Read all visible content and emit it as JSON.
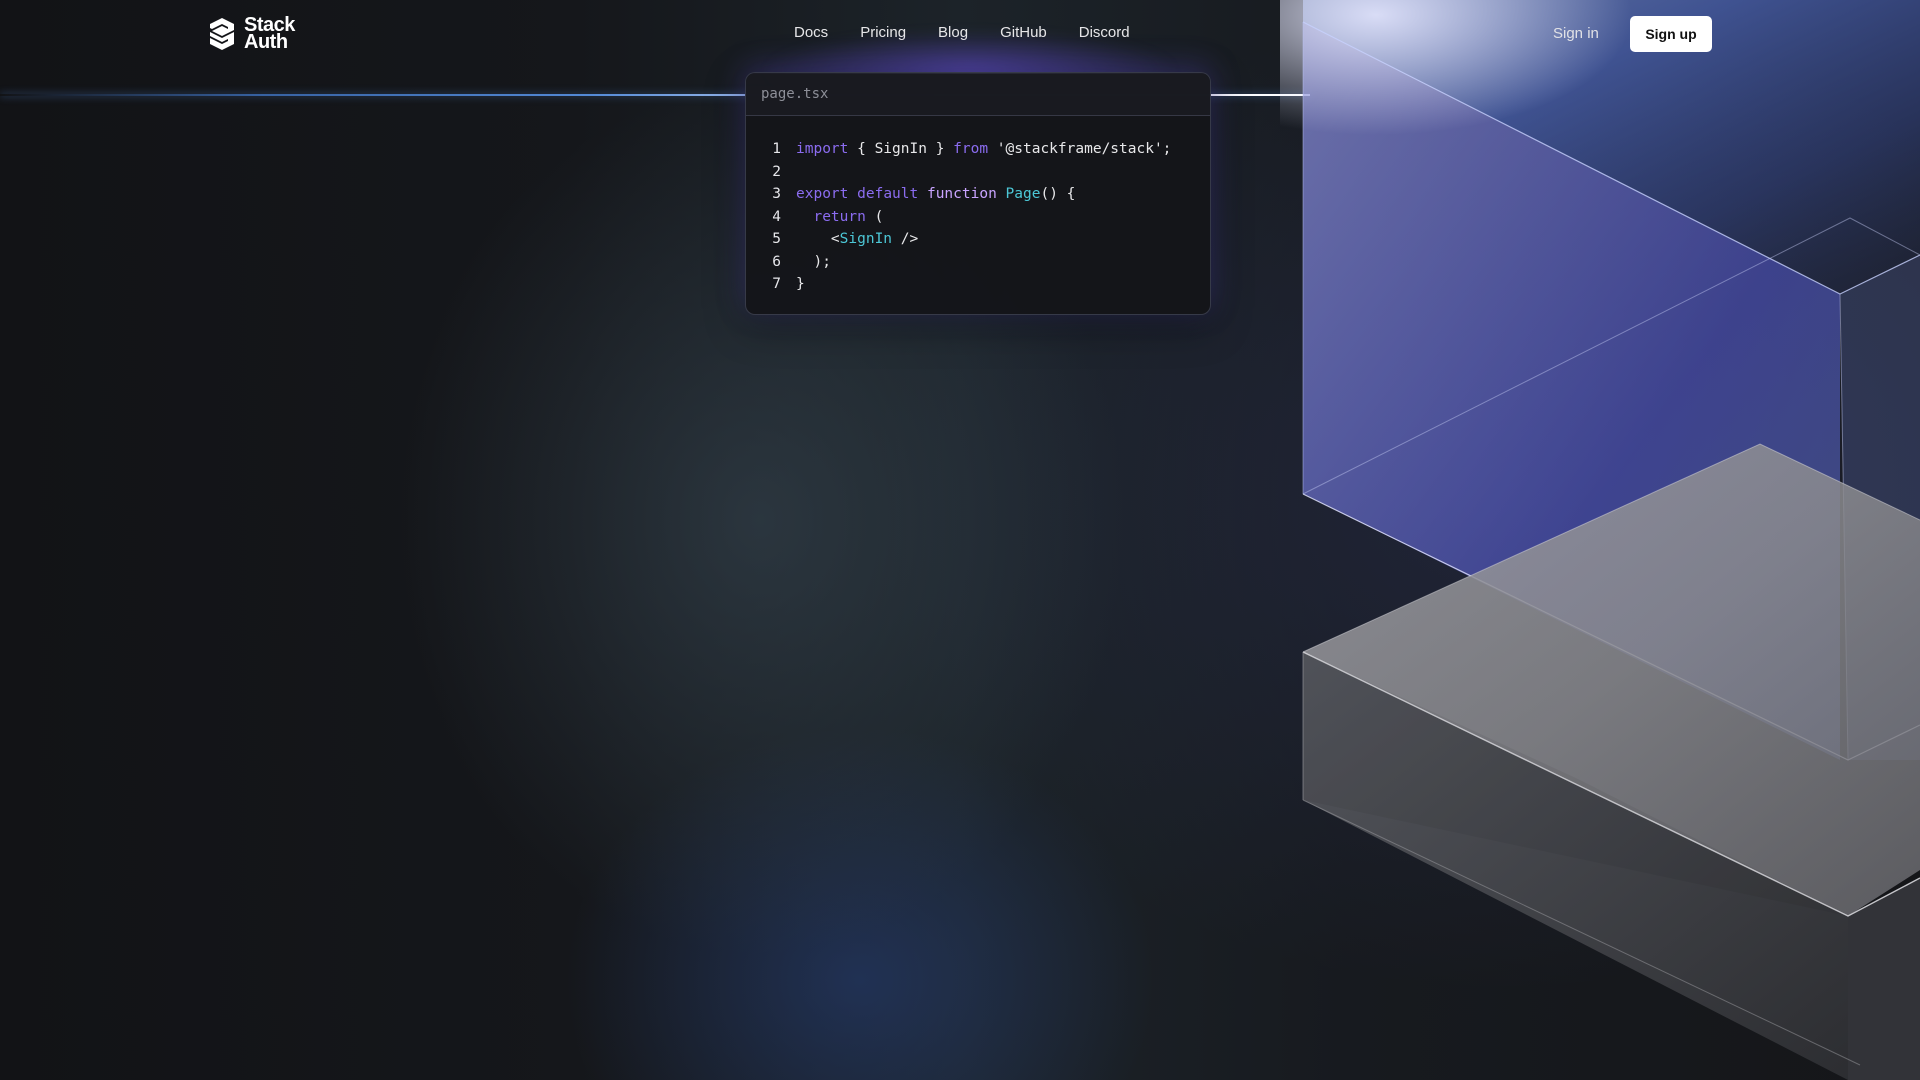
{
  "brand": {
    "line1": "Stack",
    "line2": "Auth"
  },
  "nav": {
    "items": [
      {
        "label": "Docs"
      },
      {
        "label": "Pricing"
      },
      {
        "label": "Blog"
      },
      {
        "label": "GitHub"
      },
      {
        "label": "Discord"
      }
    ]
  },
  "auth": {
    "sign_in": "Sign in",
    "sign_up": "Sign up"
  },
  "code": {
    "filename": "page.tsx",
    "lines": [
      {
        "num": "1",
        "tokens": [
          [
            "kw",
            "import"
          ],
          [
            "str",
            " { SignIn } "
          ],
          [
            "kw",
            "from"
          ],
          [
            "str",
            " '@stackframe/stack';"
          ]
        ]
      },
      {
        "num": "2",
        "tokens": []
      },
      {
        "num": "3",
        "tokens": [
          [
            "kw",
            "export"
          ],
          [
            "str",
            " "
          ],
          [
            "kw",
            "default"
          ],
          [
            "str",
            " "
          ],
          [
            "fn",
            "function"
          ],
          [
            "str",
            " "
          ],
          [
            "cmp",
            "Page"
          ],
          [
            "str",
            "() {"
          ]
        ]
      },
      {
        "num": "4",
        "tokens": [
          [
            "str",
            "  "
          ],
          [
            "kw",
            "return"
          ],
          [
            "str",
            " ("
          ]
        ]
      },
      {
        "num": "5",
        "tokens": [
          [
            "str",
            "    <"
          ],
          [
            "cmp",
            "SignIn"
          ],
          [
            "str",
            " />"
          ]
        ]
      },
      {
        "num": "6",
        "tokens": [
          [
            "str",
            "  );"
          ]
        ]
      },
      {
        "num": "7",
        "tokens": [
          [
            "str",
            "}"
          ]
        ]
      }
    ]
  },
  "colors": {
    "keyword": "#8b6cf0",
    "function_keyword": "#c9a4ff",
    "component": "#4cc7d6",
    "accent_glow": "#6a5cff"
  },
  "icons": {
    "logo": "stack-auth-logo-icon"
  }
}
